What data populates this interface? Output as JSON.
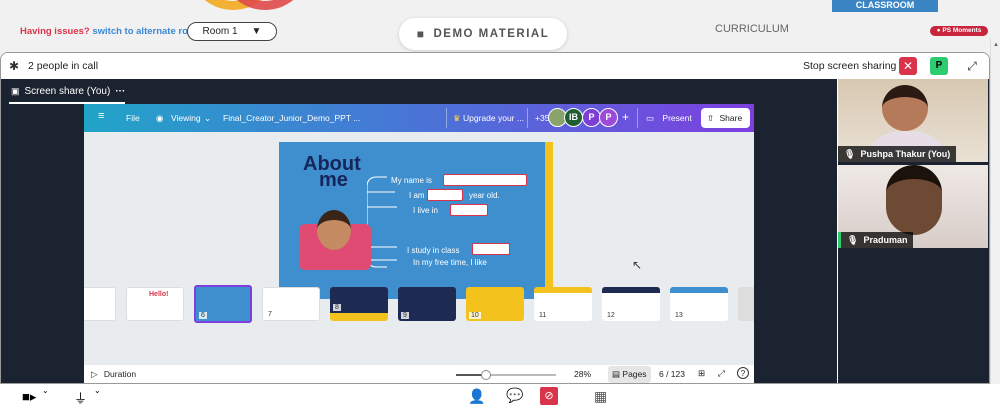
{
  "header": {
    "issue_text": "Having issues?",
    "switch_text": "switch to alternate room",
    "room_value": "Room 1",
    "demo_material": "DEMO MATERIAL",
    "curriculum": "CURRICULUM",
    "classroom": "CLASSROOM",
    "ps_moments": "PS Moments"
  },
  "callbar": {
    "people_count": "2 people in call",
    "stop_share": "Stop screen sharing",
    "participant_initial": "P"
  },
  "screenshare": {
    "tab_label": "Screen share (You)",
    "tab_more": "···"
  },
  "canva": {
    "file": "File",
    "viewing": "Viewing",
    "doc_title": "Final_Creator_Junior_Demo_PPT ...",
    "upgrade": "Upgrade your ...",
    "extra_count": "+35",
    "avatars": [
      "IB",
      "P",
      "P"
    ],
    "plus": "+",
    "present": "Present",
    "share": "Share",
    "duration": "Duration",
    "zoom": "28%",
    "pages": "Pages",
    "page_counter": "6 / 123",
    "help": "?"
  },
  "slide": {
    "title_line1": "About",
    "title_line2": "me",
    "line1": "My name is",
    "line2a": "I am",
    "line2b": "year old.",
    "line3": "I live in",
    "line4": "I study in class",
    "line5": "In my free time, I like"
  },
  "thumbnails": [
    {
      "num": ""
    },
    {
      "num": "",
      "title": "Hello!"
    },
    {
      "num": "6"
    },
    {
      "num": "7"
    },
    {
      "num": "8"
    },
    {
      "num": "9"
    },
    {
      "num": "10"
    },
    {
      "num": "11"
    },
    {
      "num": "12"
    },
    {
      "num": "13"
    }
  ],
  "participants": [
    {
      "name": "Pushpa Thakur (You)"
    },
    {
      "name": "Praduman"
    }
  ],
  "colors": {
    "accent_red": "#d9344a",
    "accent_blue": "#3b89d6",
    "green": "#2ecc71",
    "slide_blue": "#3f8fcf"
  }
}
